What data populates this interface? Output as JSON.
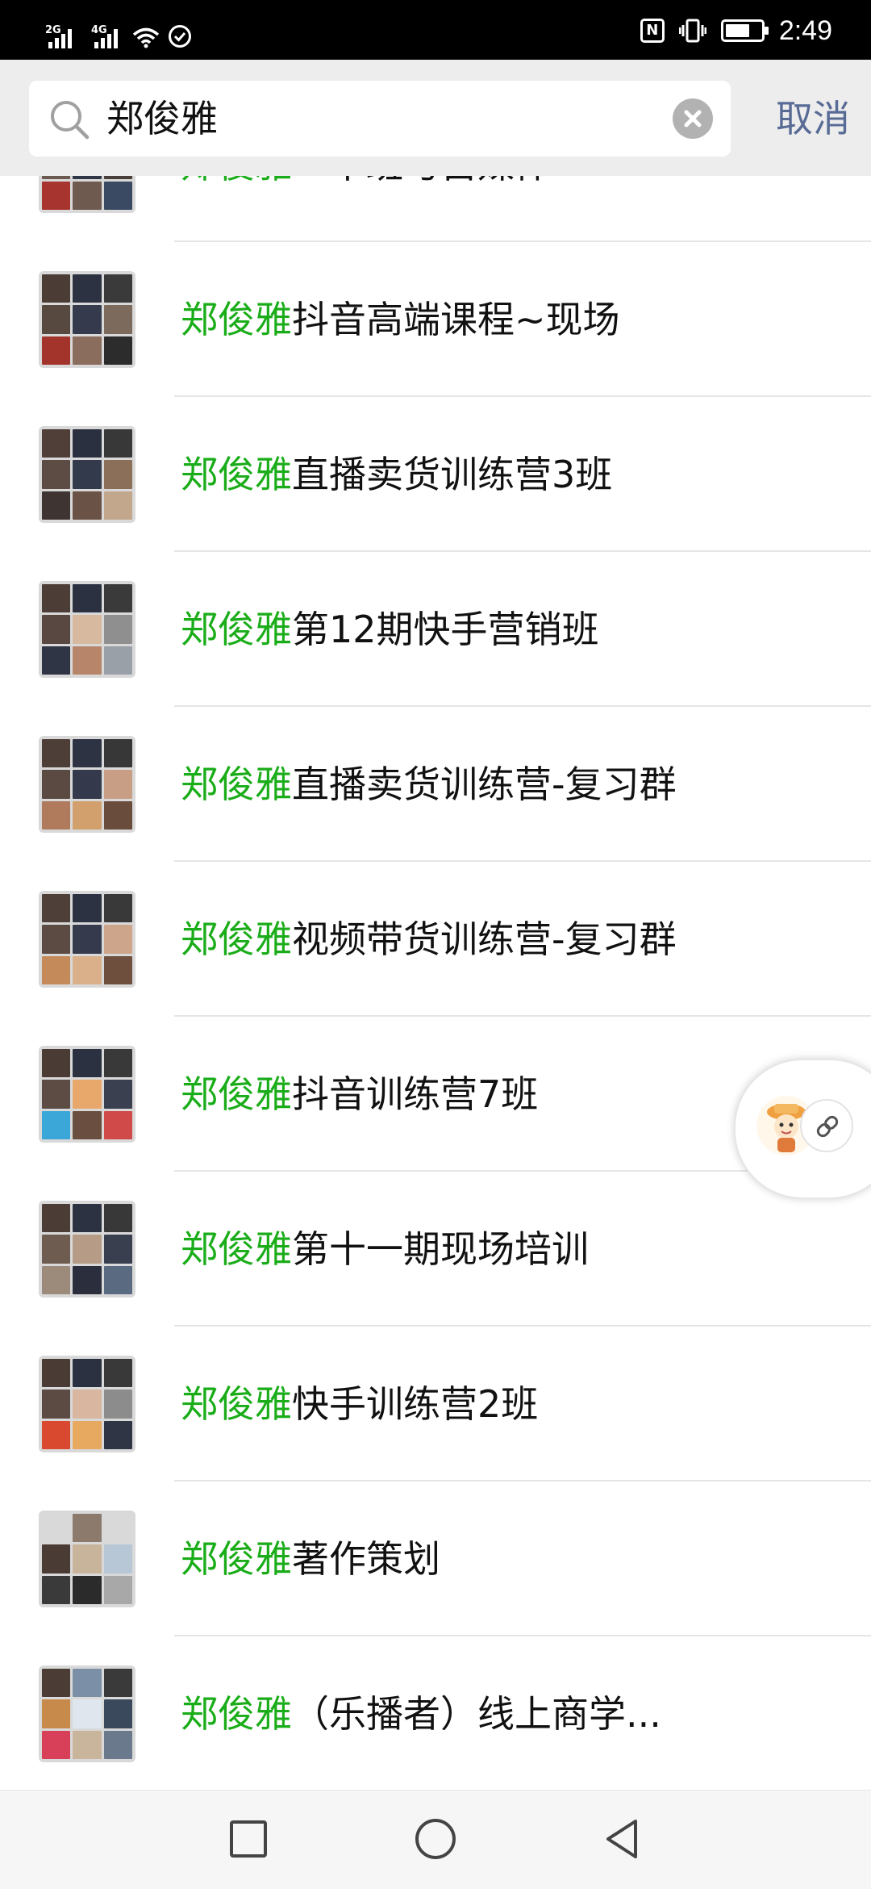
{
  "status_bar": {
    "sim1_tag": "2G",
    "sim2_tag": "4G",
    "nfc_label": "N",
    "battery_level_percent": 70,
    "time": "2:49"
  },
  "search": {
    "query": "郑俊雅",
    "cancel_label": "取消"
  },
  "results": [
    {
      "highlight": "郑俊雅",
      "rest": "一中班与自媒体",
      "partial": true
    },
    {
      "highlight": "郑俊雅",
      "rest": "抖音高端课程~现场"
    },
    {
      "highlight": "郑俊雅",
      "rest": "直播卖货训练营3班"
    },
    {
      "highlight": "郑俊雅",
      "rest": "第12期快手营销班"
    },
    {
      "highlight": "郑俊雅",
      "rest": "直播卖货训练营-复习群"
    },
    {
      "highlight": "郑俊雅",
      "rest": "视频带货训练营-复习群"
    },
    {
      "highlight": "郑俊雅",
      "rest": "抖音训练营7班"
    },
    {
      "highlight": "郑俊雅",
      "rest": "第十一期现场培训"
    },
    {
      "highlight": "郑俊雅",
      "rest": "快手训练营2班"
    },
    {
      "highlight": "郑俊雅",
      "rest": "著作策划"
    },
    {
      "highlight": "郑俊雅",
      "rest": "（乐播者）线上商学..."
    }
  ],
  "colors": {
    "highlight": "#1aad19",
    "cancel": "#576b95",
    "status_bar_bg": "#000000",
    "header_bg": "#ededed"
  },
  "icons": {
    "search": "search-icon",
    "clear": "clear-icon",
    "link": "link-icon",
    "nav_recent": "square-icon",
    "nav_home": "circle-icon",
    "nav_back": "triangle-back-icon"
  }
}
